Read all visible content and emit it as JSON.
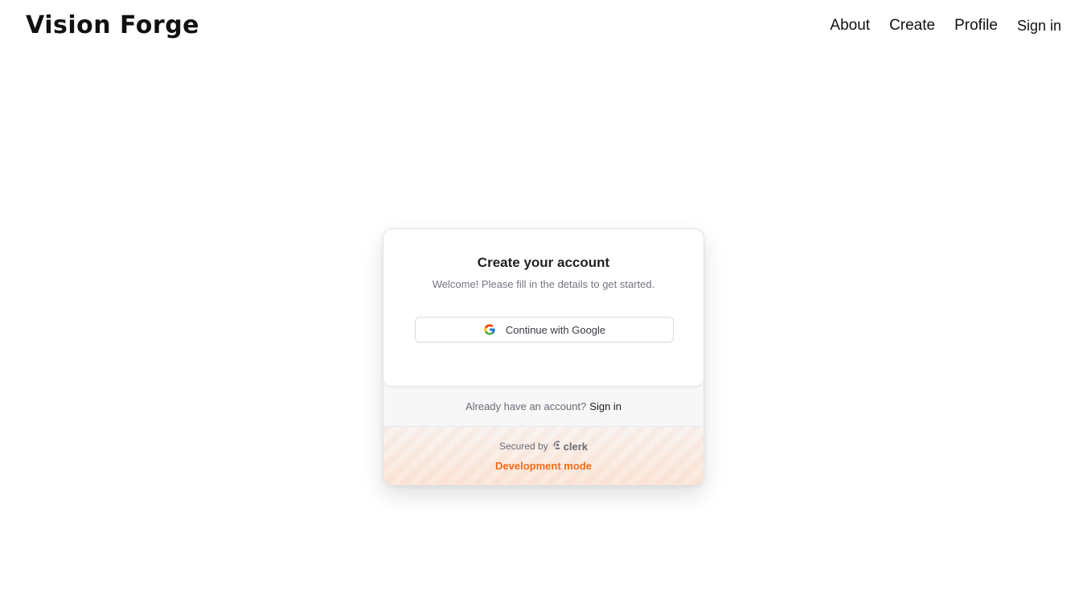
{
  "header": {
    "brand": "Vision Forge",
    "nav": {
      "about": "About",
      "create": "Create",
      "profile": "Profile",
      "sign_in": "Sign in"
    }
  },
  "signup_card": {
    "title": "Create your account",
    "subtitle": "Welcome! Please fill in the details to get started.",
    "google_button_label": "Continue with Google",
    "google_icon": "google-icon",
    "footer": {
      "already_text": "Already have an account?",
      "sign_in_link": "Sign in",
      "secured_by": "Secured by",
      "provider": "clerk",
      "dev_mode": "Development mode"
    }
  },
  "colors": {
    "dev_mode": "#f36b16",
    "text_primary": "#111111",
    "text_muted": "#747686"
  }
}
